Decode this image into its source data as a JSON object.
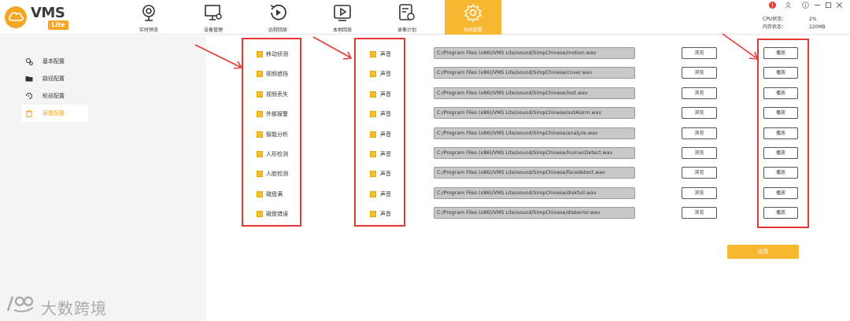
{
  "app": {
    "logo_text": "VMS",
    "logo_sub": "Lite"
  },
  "nav": [
    {
      "label": "实时预览",
      "icon": "webcam-icon"
    },
    {
      "label": "设备管理",
      "icon": "monitor-settings-icon"
    },
    {
      "label": "远程回放",
      "icon": "playback-circle-icon"
    },
    {
      "label": "本地回放",
      "icon": "local-playback-icon"
    },
    {
      "label": "录像计划",
      "icon": "schedule-icon"
    },
    {
      "label": "系统配置",
      "icon": "gear-icon"
    }
  ],
  "status": {
    "cpu_label": "CPU状态：",
    "cpu_value": "2%",
    "mem_label": "内存状态：",
    "mem_value": "220MB"
  },
  "sidebar": [
    {
      "label": "基本配置",
      "icon": "config-icon"
    },
    {
      "label": "路径配置",
      "icon": "folder-icon"
    },
    {
      "label": "轮巡配置",
      "icon": "loop-icon"
    },
    {
      "label": "报警配置",
      "icon": "trash-alarm-icon"
    }
  ],
  "alarms": [
    {
      "event": "移动侦测",
      "sound": "声音",
      "path": "C:/Program Files (x86)/VMS Lite/sound/SimpChinese/motion.wav"
    },
    {
      "event": "视频遮挡",
      "sound": "声音",
      "path": "C:/Program Files (x86)/VMS Lite/sound/SimpChinese/cover.wav"
    },
    {
      "event": "视频丢失",
      "sound": "声音",
      "path": "C:/Program Files (x86)/VMS Lite/sound/SimpChinese/lost.wav"
    },
    {
      "event": "外部报警",
      "sound": "声音",
      "path": "C:/Program Files (x86)/VMS Lite/sound/SimpChinese/outAlarm.wav"
    },
    {
      "event": "智能分析",
      "sound": "声音",
      "path": "C:/Program Files (x86)/VMS Lite/sound/SimpChinese/analyze.wav"
    },
    {
      "event": "人形检测",
      "sound": "声音",
      "path": "C:/Program Files (x86)/VMS Lite/sound/SimpChinese/humanDetect.wav"
    },
    {
      "event": "人脸检测",
      "sound": "声音",
      "path": "C:/Program Files (x86)/VMS Lite/sound/SimpChinese/facedetect.wav"
    },
    {
      "event": "磁盘满",
      "sound": "声音",
      "path": "C:/Program Files (x86)/VMS Lite/sound/SimpChinese/diskfull.wav"
    },
    {
      "event": "磁盘错误",
      "sound": "声音",
      "path": "C:/Program Files (x86)/VMS Lite/sound/SimpChinese/diskerror.wav"
    }
  ],
  "buttons": {
    "browse": "浏览",
    "play": "播放",
    "apply": "应用"
  },
  "watermark": "大数跨境",
  "colors": {
    "accent": "#f7b731",
    "highlight_box": "#e53935",
    "sidebar_bg": "#f4f4f4"
  }
}
